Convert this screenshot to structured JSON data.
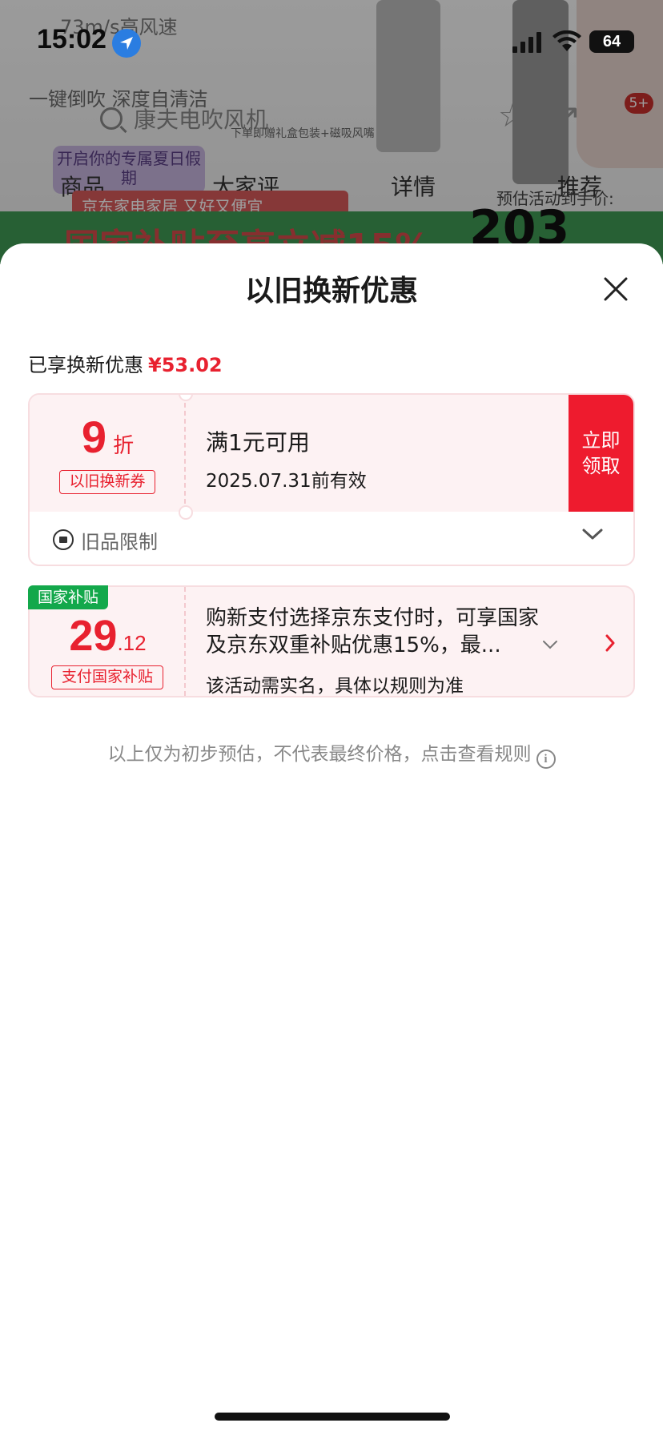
{
  "status_bar": {
    "time": "15:02",
    "battery": "64",
    "icons": [
      "location-icon",
      "signal-icon",
      "wifi-icon",
      "battery-icon"
    ]
  },
  "background": {
    "spec_text": "73m/s高风速",
    "tagline": "一键倒吹 深度自清洁",
    "search_text": "康夫电吹风机",
    "gift_text": "下单即赠礼盒包装+磁吸风嘴",
    "promo_badge": "开启你的专属夏日假期",
    "cart_count": "5+",
    "tabs": [
      "商品",
      "大家评",
      "详情",
      "推荐"
    ],
    "estimate_label": "预估活动到手价:",
    "store_strip": "京东家电家居 又好又便宜",
    "banner_text": "国家补贴至高立减15%",
    "price_partial": "203"
  },
  "sheet": {
    "title": "以旧换新优惠",
    "enjoyed_label": "已享换新优惠",
    "enjoyed_amount": "¥53.02"
  },
  "coupon": {
    "discount_number": "9",
    "discount_unit": "折",
    "tag": "以旧换新券",
    "condition": "满1元可用",
    "validity": "2025.07.31前有效",
    "claim_label": "立即领取",
    "restriction_label": "旧品限制"
  },
  "subsidy": {
    "flag": "国家补贴",
    "amount_int": "29",
    "amount_dec": ".12",
    "tag": "支付国家补贴",
    "desc_line1": "购新支付选择京东支付时，可享国家",
    "desc_line2": "及京东双重补贴优惠15%，最...",
    "note": "该活动需实名，具体以规则为准"
  },
  "disclaimer": "以上仅为初步预估，不代表最终价格，点击查看规则",
  "colors": {
    "accent_red": "#e8212f",
    "claim_red": "#ee1b2e",
    "subsidy_green": "#13a84b",
    "card_bg": "#fdf2f3"
  }
}
